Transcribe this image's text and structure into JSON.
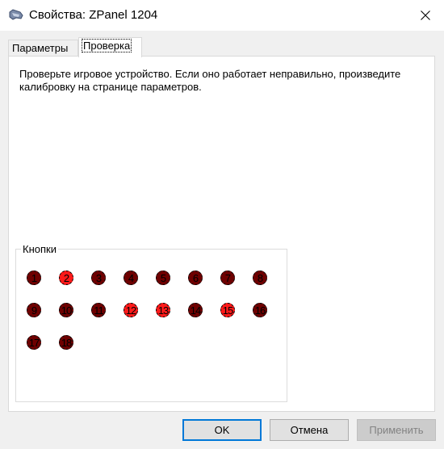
{
  "window": {
    "title": "Свойства: ZPanel 1204",
    "icon": "game-controller-icon",
    "close_icon": "close-icon"
  },
  "tabs": [
    {
      "label": "Параметры",
      "active": false
    },
    {
      "label": "Проверка",
      "active": true
    }
  ],
  "panel": {
    "instruction": "Проверьте игровое устройство. Если оно работает неправильно, произведите калибровку на странице параметров.",
    "buttons_group": {
      "label": "Кнопки",
      "buttons": [
        {
          "label": "1",
          "pressed": false
        },
        {
          "label": "2",
          "pressed": true
        },
        {
          "label": "3",
          "pressed": false
        },
        {
          "label": "4",
          "pressed": false
        },
        {
          "label": "5",
          "pressed": false
        },
        {
          "label": "6",
          "pressed": false
        },
        {
          "label": "7",
          "pressed": false
        },
        {
          "label": "8",
          "pressed": false
        },
        {
          "label": "9",
          "pressed": false
        },
        {
          "label": "10",
          "pressed": false
        },
        {
          "label": "11",
          "pressed": false
        },
        {
          "label": "12",
          "pressed": true
        },
        {
          "label": "13",
          "pressed": true
        },
        {
          "label": "14",
          "pressed": false
        },
        {
          "label": "15",
          "pressed": true
        },
        {
          "label": "16",
          "pressed": false
        },
        {
          "label": "17",
          "pressed": false
        },
        {
          "label": "18",
          "pressed": false
        }
      ]
    }
  },
  "footer": {
    "ok_label": "OK",
    "cancel_label": "Отмена",
    "apply_label": "Применить",
    "apply_disabled": true
  },
  "colors": {
    "pressed": "#ff1a1a",
    "released": "#6e0000",
    "default_button_border": "#0078d7"
  }
}
